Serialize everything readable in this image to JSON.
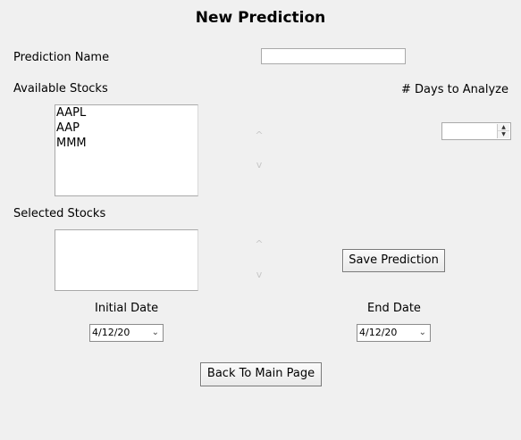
{
  "title": "New Prediction",
  "prediction_name": {
    "label": "Prediction Name",
    "value": ""
  },
  "available_stocks": {
    "label": "Available Stocks",
    "items": [
      "AAPL",
      "AAP",
      "MMM"
    ]
  },
  "days_to_analyze": {
    "label": "# Days to Analyze",
    "value": ""
  },
  "selected_stocks": {
    "label": "Selected Stocks",
    "items": []
  },
  "buttons": {
    "save": "Save Prediction",
    "back": "Back To Main Page"
  },
  "initial_date": {
    "label": "Initial Date",
    "value": "4/12/20"
  },
  "end_date": {
    "label": "End Date",
    "value": "4/12/20"
  },
  "icons": {
    "scroll_up": "^",
    "scroll_down": "v",
    "spin_up": "▲",
    "spin_down": "▼",
    "combo_arrow": "⌄"
  }
}
